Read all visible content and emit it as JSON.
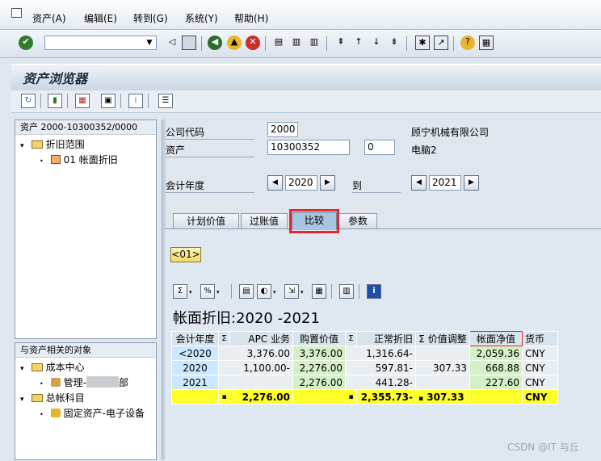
{
  "menu": {
    "asset": "资产(A)",
    "edit": "编辑(E)",
    "goto": "转到(G)",
    "system": "系统(Y)",
    "help": "帮助(H)"
  },
  "screen_title": "资产浏览器",
  "tree": {
    "header": "资产 2000-10300352/0000",
    "node_depr_area": "折旧范围",
    "node_book_depr": "01  帐面折旧"
  },
  "related": {
    "header": "与资产相关的对象",
    "node_cost_center": "成本中心",
    "node_mgmt_prefix": "管理-",
    "node_mgmt_suffix": "部",
    "node_gl_account": "总帐科目",
    "node_fixed_asset": "固定资产-电子设备"
  },
  "form": {
    "company_code_label": "公司代码",
    "company_code": "2000",
    "company_name": "顾宁机械有限公司",
    "asset_label": "资产",
    "asset_number": "10300352",
    "asset_sub": "0",
    "asset_desc": "电脑2",
    "fiscal_year_label": "会计年度",
    "year_from": "2020",
    "to_label": "到",
    "year_to": "2021"
  },
  "tabs": [
    {
      "label": "计划价值"
    },
    {
      "label": "过账值"
    },
    {
      "label": "比较"
    },
    {
      "label": "参数"
    }
  ],
  "area_button": "<01>",
  "grid_title": "帐面折旧:2020 -2021",
  "grid": {
    "headers": [
      "会计年度",
      "Σ",
      "APC 业务",
      "购置价值",
      "Σ",
      "正常折旧",
      "Σ 价值调整",
      "帐面净值",
      "货币"
    ],
    "rows": [
      {
        "year": "<2020",
        "apc": "3,376.00",
        "acq": "3,376.00",
        "dep": "1,316.64-",
        "adj": "",
        "nbv": "2,059.36",
        "cur": "CNY"
      },
      {
        "year": "2020",
        "apc": "1,100.00-",
        "acq": "2,276.00",
        "dep": "597.81-",
        "adj": "307.33",
        "nbv": "668.88",
        "cur": "CNY"
      },
      {
        "year": "2021",
        "apc": "",
        "acq": "2,276.00",
        "dep": "441.28-",
        "adj": "",
        "nbv": "227.60",
        "cur": "CNY"
      }
    ],
    "total": {
      "dot": "▪",
      "apc": "2,276.00",
      "dep": "2,355.73-",
      "adj": "307.33",
      "cur": "CNY"
    }
  },
  "watermark": "CSDN @IT 与丘",
  "colors": {
    "highlight_border": "#e8262d",
    "total_row": "#ffff2a",
    "green_cell": "#d3f0c6",
    "blue_cell": "#cce8ff"
  }
}
